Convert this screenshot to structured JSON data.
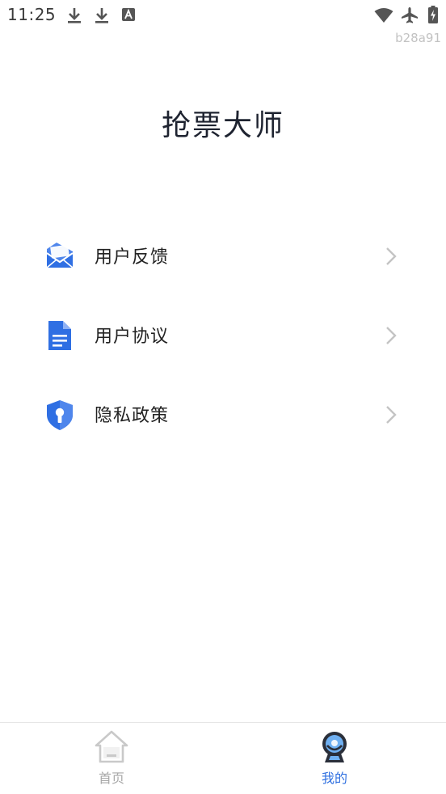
{
  "status_bar": {
    "time": "11:25",
    "left_icons": [
      "download-icon",
      "download-icon",
      "translate-icon"
    ],
    "right_icons": [
      "wifi-icon",
      "airplane-mode-icon",
      "battery-charging-icon"
    ]
  },
  "build_tag": "b28a91",
  "header": {
    "title": "抢票大师"
  },
  "menu": {
    "items": [
      {
        "label": "用户反馈",
        "icon": "mail-icon"
      },
      {
        "label": "用户协议",
        "icon": "document-icon"
      },
      {
        "label": "隐私政策",
        "icon": "shield-lock-icon"
      }
    ]
  },
  "bottom_nav": {
    "tabs": [
      {
        "label": "首页",
        "icon": "home-icon",
        "active": false
      },
      {
        "label": "我的",
        "icon": "profile-icon",
        "active": true
      }
    ]
  },
  "colors": {
    "accent": "#2e6fe0",
    "icon_blue": "#2f6fe3",
    "inactive": "#a8a8a8",
    "chevron": "#c4c4c4"
  }
}
